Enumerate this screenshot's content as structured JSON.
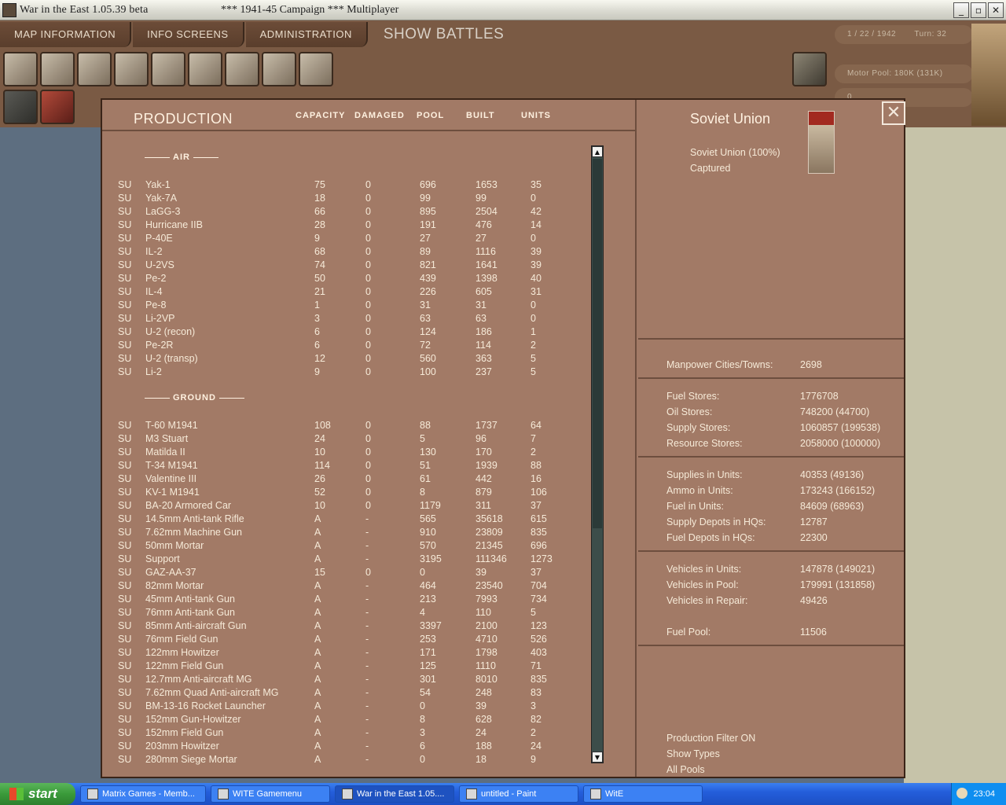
{
  "window": {
    "title": "War in the East 1.05.39 beta",
    "subtitle": "***   1941-45 Campaign   ***   Multiplayer"
  },
  "menu": {
    "tabs": [
      "MAP INFORMATION",
      "INFO SCREENS",
      "ADMINISTRATION"
    ],
    "show_battles": "SHOW BATTLES"
  },
  "header_info": {
    "date": "1 / 22 / 1942",
    "turn": "Turn: 32",
    "motor_pool": "Motor Pool:  180K (131K)",
    "extra": "0"
  },
  "production": {
    "title": "PRODUCTION",
    "columns": [
      "CAPACITY",
      "DAMAGED",
      "POOL",
      "BUILT",
      "UNITS"
    ],
    "air_title": "AIR",
    "ground_title": "GROUND",
    "air": [
      [
        "SU",
        "Yak-1",
        "75",
        "0",
        "696",
        "1653",
        "35"
      ],
      [
        "SU",
        "Yak-7A",
        "18",
        "0",
        "99",
        "99",
        "0"
      ],
      [
        "SU",
        "LaGG-3",
        "66",
        "0",
        "895",
        "2504",
        "42"
      ],
      [
        "SU",
        "Hurricane IIB",
        "28",
        "0",
        "191",
        "476",
        "14"
      ],
      [
        "SU",
        "P-40E",
        "9",
        "0",
        "27",
        "27",
        "0"
      ],
      [
        "SU",
        "IL-2",
        "68",
        "0",
        "89",
        "1116",
        "39"
      ],
      [
        "SU",
        "U-2VS",
        "74",
        "0",
        "821",
        "1641",
        "39"
      ],
      [
        "SU",
        "Pe-2",
        "50",
        "0",
        "439",
        "1398",
        "40"
      ],
      [
        "SU",
        "IL-4",
        "21",
        "0",
        "226",
        "605",
        "31"
      ],
      [
        "SU",
        "Pe-8",
        "1",
        "0",
        "31",
        "31",
        "0"
      ],
      [
        "SU",
        "Li-2VP",
        "3",
        "0",
        "63",
        "63",
        "0"
      ],
      [
        "SU",
        "U-2 (recon)",
        "6",
        "0",
        "124",
        "186",
        "1"
      ],
      [
        "SU",
        "Pe-2R",
        "6",
        "0",
        "72",
        "114",
        "2"
      ],
      [
        "SU",
        "U-2 (transp)",
        "12",
        "0",
        "560",
        "363",
        "5"
      ],
      [
        "SU",
        "Li-2",
        "9",
        "0",
        "100",
        "237",
        "5"
      ]
    ],
    "ground": [
      [
        "SU",
        "T-60 M1941",
        "108",
        "0",
        "88",
        "1737",
        "64"
      ],
      [
        "SU",
        "M3 Stuart",
        "24",
        "0",
        "5",
        "96",
        "7"
      ],
      [
        "SU",
        "Matilda II",
        "10",
        "0",
        "130",
        "170",
        "2"
      ],
      [
        "SU",
        "T-34 M1941",
        "114",
        "0",
        "51",
        "1939",
        "88"
      ],
      [
        "SU",
        "Valentine III",
        "26",
        "0",
        "61",
        "442",
        "16"
      ],
      [
        "SU",
        "KV-1 M1941",
        "52",
        "0",
        "8",
        "879",
        "106"
      ],
      [
        "SU",
        "BA-20 Armored Car",
        "10",
        "0",
        "1179",
        "311",
        "37"
      ],
      [
        "SU",
        "14.5mm Anti-tank Rifle",
        "A",
        "-",
        "565",
        "35618",
        "615"
      ],
      [
        "SU",
        "7.62mm Machine Gun",
        "A",
        "-",
        "910",
        "23809",
        "835"
      ],
      [
        "SU",
        "50mm Mortar",
        "A",
        "-",
        "570",
        "21345",
        "696"
      ],
      [
        "SU",
        "Support",
        "A",
        "-",
        "3195",
        "111346",
        "1273"
      ],
      [
        "SU",
        "GAZ-AA-37",
        "15",
        "0",
        "0",
        "39",
        "37"
      ],
      [
        "SU",
        "82mm Mortar",
        "A",
        "-",
        "464",
        "23540",
        "704"
      ],
      [
        "SU",
        "45mm Anti-tank Gun",
        "A",
        "-",
        "213",
        "7993",
        "734"
      ],
      [
        "SU",
        "76mm Anti-tank Gun",
        "A",
        "-",
        "4",
        "110",
        "5"
      ],
      [
        "SU",
        "85mm Anti-aircraft Gun",
        "A",
        "-",
        "3397",
        "2100",
        "123"
      ],
      [
        "SU",
        "76mm Field Gun",
        "A",
        "-",
        "253",
        "4710",
        "526"
      ],
      [
        "SU",
        "122mm Howitzer",
        "A",
        "-",
        "171",
        "1798",
        "403"
      ],
      [
        "SU",
        "122mm Field Gun",
        "A",
        "-",
        "125",
        "1110",
        "71"
      ],
      [
        "SU",
        "12.7mm Anti-aircraft MG",
        "A",
        "-",
        "301",
        "8010",
        "835"
      ],
      [
        "SU",
        "7.62mm Quad Anti-aircraft MG",
        "A",
        "-",
        "54",
        "248",
        "83"
      ],
      [
        "SU",
        "BM-13-16 Rocket Launcher",
        "A",
        "-",
        "0",
        "39",
        "3"
      ],
      [
        "SU",
        "152mm Gun-Howitzer",
        "A",
        "-",
        "8",
        "628",
        "82"
      ],
      [
        "SU",
        "152mm Field Gun",
        "A",
        "-",
        "3",
        "24",
        "2"
      ],
      [
        "SU",
        "203mm Howitzer",
        "A",
        "-",
        "6",
        "188",
        "24"
      ],
      [
        "SU",
        "280mm Siege Mortar",
        "A",
        "-",
        "0",
        "18",
        "9"
      ]
    ]
  },
  "nation": {
    "title": "Soviet Union",
    "line1": "Soviet Union  (100%)",
    "line2": "Captured"
  },
  "stats": {
    "manpower": [
      [
        "Manpower Cities/Towns:",
        "2698"
      ]
    ],
    "stores": [
      [
        "Fuel Stores:",
        "1776708"
      ],
      [
        "Oil Stores:",
        "748200 (44700)"
      ],
      [
        "Supply Stores:",
        "1060857 (199538)"
      ],
      [
        "Resource Stores:",
        "2058000 (100000)"
      ]
    ],
    "units": [
      [
        "Supplies in Units:",
        "40353 (49136)"
      ],
      [
        "Ammo in Units:",
        "173243 (166152)"
      ],
      [
        "Fuel in Units:",
        "84609 (68963)"
      ],
      [
        "Supply Depots in HQs:",
        "12787"
      ],
      [
        "Fuel Depots in HQs:",
        "22300"
      ]
    ],
    "vehicles": [
      [
        "Vehicles in Units:",
        "147878 (149021)"
      ],
      [
        "Vehicles in Pool:",
        "179991 (131858)"
      ],
      [
        "Vehicles in Repair:",
        "49426"
      ]
    ],
    "fuel_pool": [
      "Fuel Pool:",
      "11506"
    ]
  },
  "filters": [
    "Production Filter ON",
    "Show Types",
    "All Pools"
  ],
  "taskbar": {
    "start": "start",
    "tasks": [
      "Matrix Games - Memb...",
      "WITE Gamemenu",
      "War in the East 1.05....",
      "untitled - Paint",
      "WitE"
    ],
    "clock": "23:04"
  }
}
